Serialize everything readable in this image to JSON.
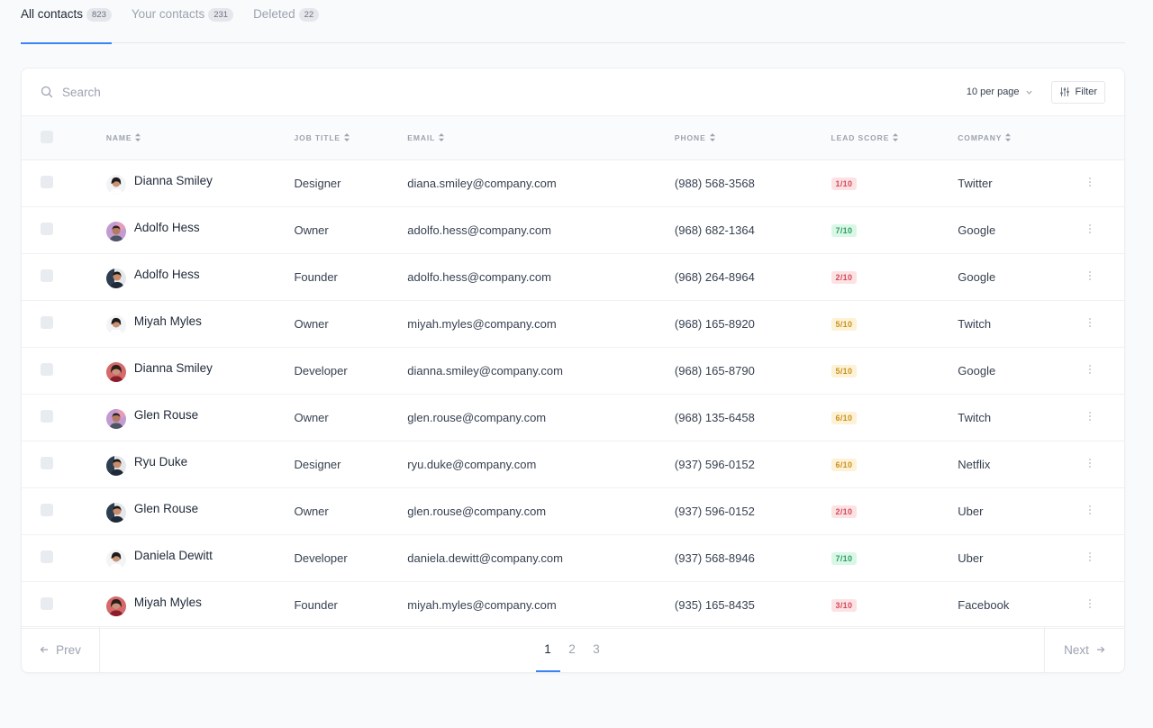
{
  "tabs": [
    {
      "label": "All contacts",
      "count": "823",
      "active": true
    },
    {
      "label": "Your contacts",
      "count": "231",
      "active": false
    },
    {
      "label": "Deleted",
      "count": "22",
      "active": false
    }
  ],
  "toolbar": {
    "search_placeholder": "Search",
    "per_page": "10 per page",
    "filter_label": "Filter"
  },
  "columns": {
    "name": "Name",
    "job_title": "Job title",
    "email": "Email",
    "phone": "Phone",
    "lead_score": "Lead score",
    "company": "Company"
  },
  "rows": [
    {
      "name": "Dianna Smiley",
      "job": "Designer",
      "email": "diana.smiley@company.com",
      "phone": "(988) 568-3568",
      "score": "1/10",
      "score_level": "red",
      "company": "Twitter",
      "avatar": 0
    },
    {
      "name": "Adolfo Hess",
      "job": "Owner",
      "email": "adolfo.hess@company.com",
      "phone": "(968) 682-1364",
      "score": "7/10",
      "score_level": "green",
      "company": "Google",
      "avatar": 1
    },
    {
      "name": "Adolfo Hess",
      "job": "Founder",
      "email": "adolfo.hess@company.com",
      "phone": "(968) 264-8964",
      "score": "2/10",
      "score_level": "red",
      "company": "Google",
      "avatar": 2
    },
    {
      "name": "Miyah Myles",
      "job": "Owner",
      "email": "miyah.myles@company.com",
      "phone": "(968) 165-8920",
      "score": "5/10",
      "score_level": "yellow",
      "company": "Twitch",
      "avatar": 0
    },
    {
      "name": "Dianna Smiley",
      "job": "Developer",
      "email": "dianna.smiley@company.com",
      "phone": "(968) 165-8790",
      "score": "5/10",
      "score_level": "yellow",
      "company": "Google",
      "avatar": 3
    },
    {
      "name": "Glen Rouse",
      "job": "Owner",
      "email": "glen.rouse@company.com",
      "phone": "(968) 135-6458",
      "score": "6/10",
      "score_level": "yellow",
      "company": "Twitch",
      "avatar": 1
    },
    {
      "name": "Ryu Duke",
      "job": "Designer",
      "email": "ryu.duke@company.com",
      "phone": "(937) 596-0152",
      "score": "6/10",
      "score_level": "yellow",
      "company": "Netflix",
      "avatar": 2
    },
    {
      "name": "Glen Rouse",
      "job": "Owner",
      "email": "glen.rouse@company.com",
      "phone": "(937) 596-0152",
      "score": "2/10",
      "score_level": "red",
      "company": "Uber",
      "avatar": 2
    },
    {
      "name": "Daniela Dewitt",
      "job": "Developer",
      "email": "daniela.dewitt@company.com",
      "phone": "(937) 568-8946",
      "score": "7/10",
      "score_level": "green",
      "company": "Uber",
      "avatar": 0
    },
    {
      "name": "Miyah Myles",
      "job": "Founder",
      "email": "miyah.myles@company.com",
      "phone": "(935) 165-8435",
      "score": "3/10",
      "score_level": "red",
      "company": "Facebook",
      "avatar": 3
    }
  ],
  "pagination": {
    "prev_label": "Prev",
    "next_label": "Next",
    "pages": [
      "1",
      "2",
      "3"
    ],
    "current": "1"
  },
  "icons": {
    "search": "search-icon",
    "chevron": "chevron-down-icon",
    "filter": "sliders-icon",
    "sort": "sort-icon",
    "more": "more-vertical-icon",
    "prev": "arrow-left-icon",
    "next": "arrow-right-icon"
  },
  "colors": {
    "accent": "#3b82f6",
    "score_red_bg": "#fde2e4",
    "score_green_bg": "#d9f7e6",
    "score_yellow_bg": "#fdf1d6"
  }
}
